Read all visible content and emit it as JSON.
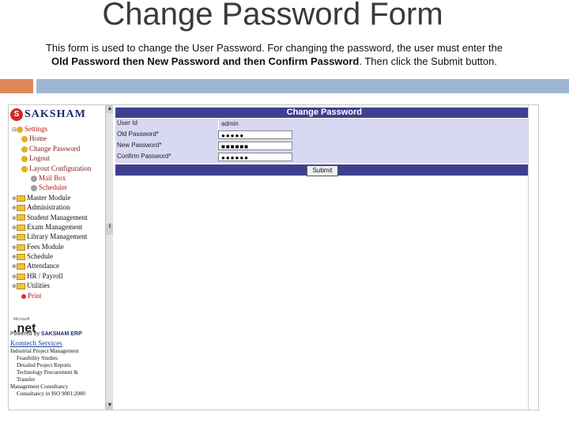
{
  "slide": {
    "title": "Change Password Form",
    "desc_part1": "This form is used to change the User Password. For changing the password, the user must enter the ",
    "desc_bold1": "Old Password then New Password and then Confirm Password",
    "desc_part2": ". Then click the Submit button."
  },
  "brand": {
    "logo_letter": "S",
    "logo_word": "SAKSHAM"
  },
  "tree": {
    "settings": "Settings",
    "home": "Home",
    "change_password": "Change Password",
    "logout": "Logout",
    "layout_configuration": "Layout Configuration",
    "mail_box": "Mail Box",
    "scheduler": "Scheduler",
    "master_module": "Master Module",
    "administration": "Administration",
    "student_management": "Student Management",
    "exam_management": "Exam Management",
    "library_management": "Library Management",
    "fees_module": "Fees Module",
    "schedule": "Schedule",
    "attendance": "Attendance",
    "hr_payroll": "HR / Payroll",
    "utilities": "Utilities",
    "print": "Print"
  },
  "footer_left": {
    "net_small": "Microsoft",
    "net_word": ".net",
    "powered_by": "Powered by",
    "powered_brand": "SAKSHAM ERP",
    "komtech": "Komtech Services",
    "services": [
      "Industrial Project Management",
      "Feasibility Studies",
      "Detailed Project Reports",
      "Technology Procurement &",
      "Transfer",
      "Management Consultancy",
      "Consultancy in ISO 9001:2000"
    ]
  },
  "form": {
    "header": "Change Password",
    "user_id_label": "User Id",
    "user_id_value": "admin",
    "old_password_label": "Old Password*",
    "old_password_value": "●●●●●",
    "new_password_label": "New Password*",
    "new_password_value": "■■■■■■",
    "confirm_password_label": "Confirm Password*",
    "confirm_password_value": "●●●●●●",
    "submit_label": "Submit"
  },
  "colors": {
    "orange_bar": "#e0875a",
    "blue_bar": "#9fb7d4",
    "form_header": "#3f3f8f",
    "form_row": "#d8d8f2"
  }
}
